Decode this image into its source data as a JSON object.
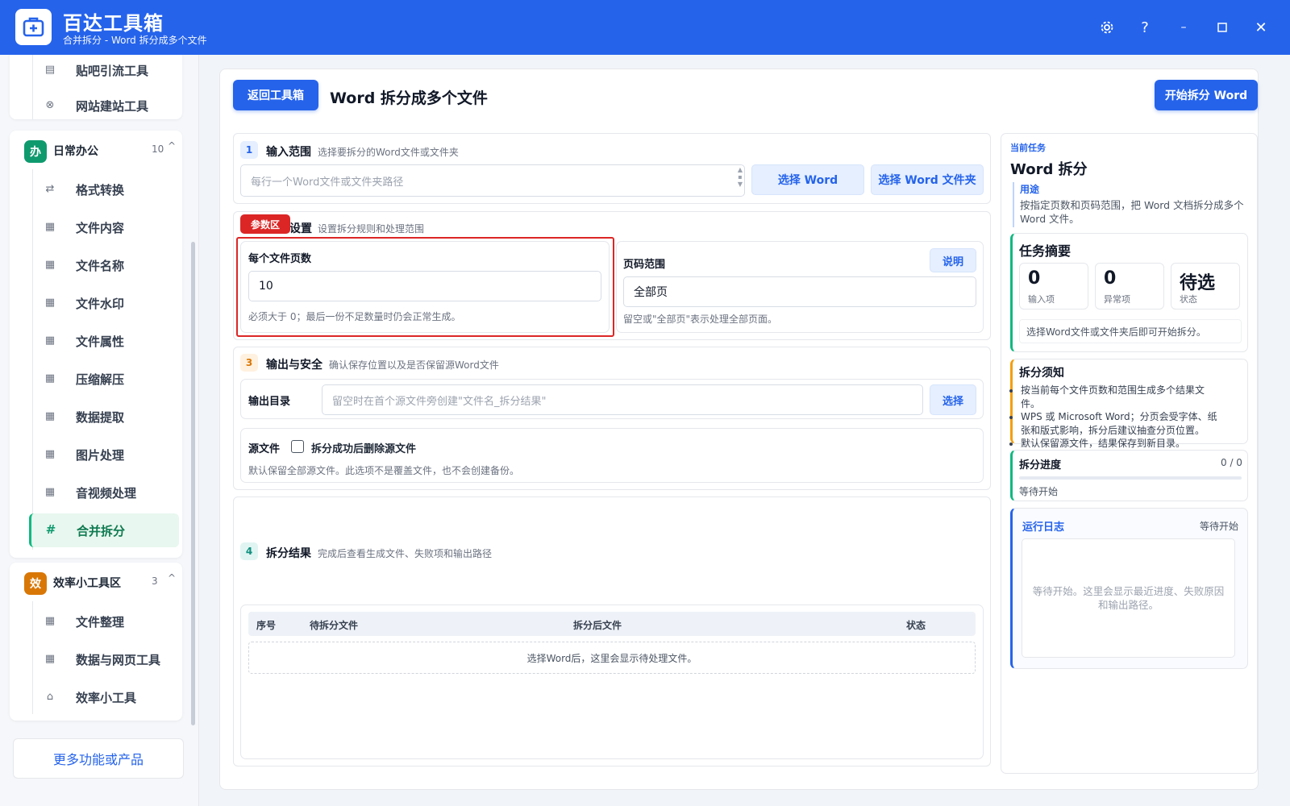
{
  "window": {
    "title": "百达工具箱",
    "subtitle": "合并拆分 - Word 拆分成多个文件"
  },
  "sidebar": {
    "top_items": [
      {
        "icon": "document-icon",
        "label": "贴吧引流工具"
      },
      {
        "icon": "globe-icon",
        "label": "网站建站工具"
      }
    ],
    "groups": [
      {
        "badge": "办",
        "badge_color": "#0f9a6e",
        "label": "日常办公",
        "count": "10",
        "caret": "^",
        "items": [
          {
            "icon": "swap-icon",
            "label": "格式转换"
          },
          {
            "icon": "grid-icon",
            "label": "文件内容"
          },
          {
            "icon": "grid-icon",
            "label": "文件名称"
          },
          {
            "icon": "grid-icon",
            "label": "文件水印"
          },
          {
            "icon": "grid-icon",
            "label": "文件属性"
          },
          {
            "icon": "grid-icon",
            "label": "压缩解压"
          },
          {
            "icon": "grid-icon",
            "label": "数据提取"
          },
          {
            "icon": "grid-icon",
            "label": "图片处理"
          },
          {
            "icon": "grid-icon",
            "label": "音视频处理"
          },
          {
            "icon": "hash-icon",
            "label": "合并拆分",
            "active": true
          }
        ]
      },
      {
        "badge": "效",
        "badge_color": "#d97706",
        "label": "效率小工具区",
        "count": "3",
        "caret": "^",
        "items": [
          {
            "icon": "grid-icon",
            "label": "文件整理"
          },
          {
            "icon": "grid-icon",
            "label": "数据与网页工具"
          },
          {
            "icon": "toolbox-icon",
            "label": "效率小工具"
          }
        ]
      }
    ],
    "more_label": "更多功能或产品"
  },
  "header": {
    "back_label": "返回工具箱",
    "page_title": "Word 拆分成多个文件",
    "start_label": "开始拆分 Word"
  },
  "section1": {
    "num": "1",
    "title": "输入范围",
    "desc": "选择要拆分的Word文件或文件夹",
    "input_placeholder": "每行一个Word文件或文件夹路径",
    "btn_select_word": "选择 Word",
    "btn_select_folder": "选择 Word 文件夹"
  },
  "section2": {
    "tag": "参数区",
    "title": "设置",
    "desc": "设置拆分规则和处理范围",
    "pages_label": "每个文件页数",
    "pages_value": "10",
    "pages_hint": "必须大于 0；最后一份不足数量时仍会正常生成。",
    "range_label": "页码范围",
    "range_help": "说明",
    "range_value": "全部页",
    "range_hint": "留空或\"全部页\"表示处理全部页面。"
  },
  "section3": {
    "num": "3",
    "title": "输出与安全",
    "desc": "确认保存位置以及是否保留源Word文件",
    "output_label": "输出目录",
    "output_placeholder": "留空时在首个源文件旁创建\"文件名_拆分结果\"",
    "output_btn": "选择",
    "source_label": "源文件",
    "delete_label": "拆分成功后删除源文件",
    "delete_checked": false,
    "source_hint": "默认保留全部源文件。此选项不是覆盖文件，也不会创建备份。"
  },
  "section4": {
    "num": "4",
    "title": "拆分结果",
    "desc": "完成后查看生成文件、失败项和输出路径",
    "columns": [
      "序号",
      "待拆分文件",
      "拆分后文件",
      "状态"
    ],
    "empty_text": "选择Word后，这里会显示待处理文件。"
  },
  "right": {
    "task_kicker": "当前任务",
    "task_title": "Word 拆分",
    "usage_label": "用途",
    "usage_text": "按指定页数和页码范围，把 Word 文档拆分成多个 Word 文件。",
    "summary_title": "任务摘要",
    "stats": [
      {
        "value": "0",
        "label": "输入项"
      },
      {
        "value": "0",
        "label": "异常项"
      },
      {
        "value": "待选",
        "label": "状态"
      }
    ],
    "summary_hint": "选择Word文件或文件夹后即可开始拆分。",
    "notes_title": "拆分须知",
    "notes": [
      "按当前每个文件页数和范围生成多个结果文件。",
      "WPS 或 Microsoft Word；分页会受字体、纸张和版式影响，拆分后建议抽查分页位置。",
      "默认保留源文件，结果保存到新目录。"
    ],
    "progress_title": "拆分进度",
    "progress_count": "0 / 0",
    "progress_fraction": 0,
    "progress_status": "等待开始",
    "log_title": "运行日志",
    "log_status": "等待开始",
    "log_placeholder": "等待开始。这里会显示最近进度、失败原因和输出路径。"
  },
  "colors": {
    "brand": "#2563eb",
    "accent_green": "#10b981",
    "highlight_red": "#dc2626"
  }
}
